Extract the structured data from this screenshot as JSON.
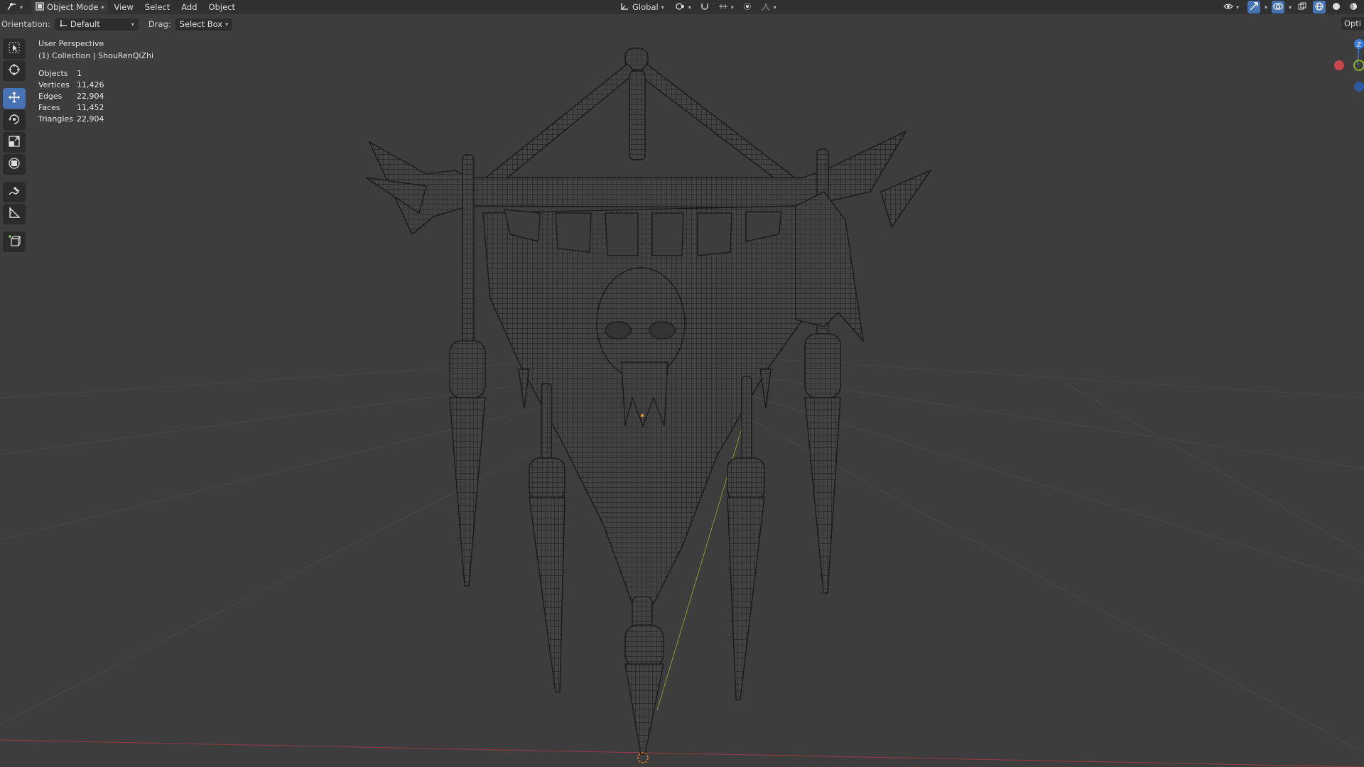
{
  "header": {
    "mode": "Object Mode",
    "menus": [
      "View",
      "Select",
      "Add",
      "Object"
    ],
    "transform_orientation": "Global"
  },
  "tool_settings": {
    "orientation_label": "Orientation:",
    "orientation_value": "Default",
    "drag_label": "Drag:",
    "drag_value": "Select Box",
    "options_label": "Opti"
  },
  "viewport": {
    "view_name": "User Perspective",
    "collection_info": "(1) Collection | ShouRenQiZhi",
    "stats": [
      {
        "label": "Objects",
        "value": "1"
      },
      {
        "label": "Vertices",
        "value": "11,426"
      },
      {
        "label": "Edges",
        "value": "22,904"
      },
      {
        "label": "Faces",
        "value": "11,452"
      },
      {
        "label": "Triangles",
        "value": "22,904"
      }
    ]
  },
  "toolbar": {
    "tools": [
      "select-box",
      "cursor",
      "move",
      "rotate",
      "scale",
      "transform",
      "annotate",
      "measure",
      "add-cube"
    ],
    "active_tool": "move"
  },
  "gizmo": {
    "z_label": "Z"
  },
  "colors": {
    "background": "#3d3d3d",
    "header": "#303030",
    "accent": "#4772b3",
    "wire": "#1e1e1e",
    "x_axis": "#c8474f",
    "y_axis": "#8ab524",
    "z_axis": "#3d7bd9"
  }
}
